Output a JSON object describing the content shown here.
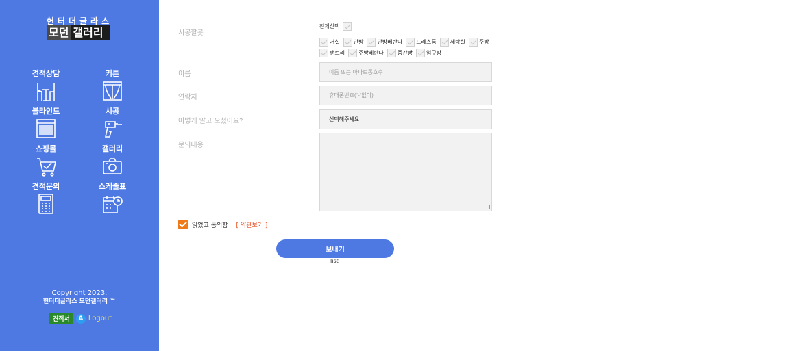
{
  "sidebar": {
    "logo_top": "헌터더글라스",
    "logo_main_a": "모던",
    "logo_main_b": "갤러리",
    "menu": [
      {
        "label": "견적상담",
        "icon": "chair-table-icon"
      },
      {
        "label": "커튼",
        "icon": "curtain-icon"
      },
      {
        "label": "블라인드",
        "icon": "blind-icon"
      },
      {
        "label": "시공",
        "icon": "drill-icon"
      },
      {
        "label": "쇼핑몰",
        "icon": "cart-icon"
      },
      {
        "label": "갤러리",
        "icon": "camera-icon"
      },
      {
        "label": "견적문의",
        "icon": "calculator-icon"
      },
      {
        "label": "스케줄표",
        "icon": "calendar-clock-icon"
      }
    ],
    "copyright_line1": "Copyright 2023.",
    "copyright_line2": "헌터더글라스 모던갤러리 ™",
    "estimate_badge": "견적서",
    "a_badge": "A",
    "logout": "Logout"
  },
  "form": {
    "location_label": "시공할곳",
    "select_all": "전체선택",
    "rooms_row1": [
      "거실",
      "안방",
      "안방베란다",
      "드레스룸",
      "세탁실",
      "주방"
    ],
    "rooms_row2": [
      "팬트리",
      "주방베란다",
      "중간방",
      "입구방"
    ],
    "name_label": "이름",
    "name_placeholder": "이름 또는 아파트동호수",
    "contact_label": "연락처",
    "contact_placeholder": "휴대폰번호('-'없이)",
    "source_label": "어떻게 알고 오셨어요?",
    "source_value": "선택해주세요",
    "inquiry_label": "문의내용",
    "agree_text": "읽었고 동의함",
    "terms_link": "[ 약관보기 ]",
    "send_label": "보내기",
    "list_label": "list"
  },
  "colors": {
    "sidebar_bg": "#4e79e3",
    "accent_orange": "#f07a18",
    "terms_red": "#e84a1a",
    "logout_yellow": "#ffe84a"
  }
}
